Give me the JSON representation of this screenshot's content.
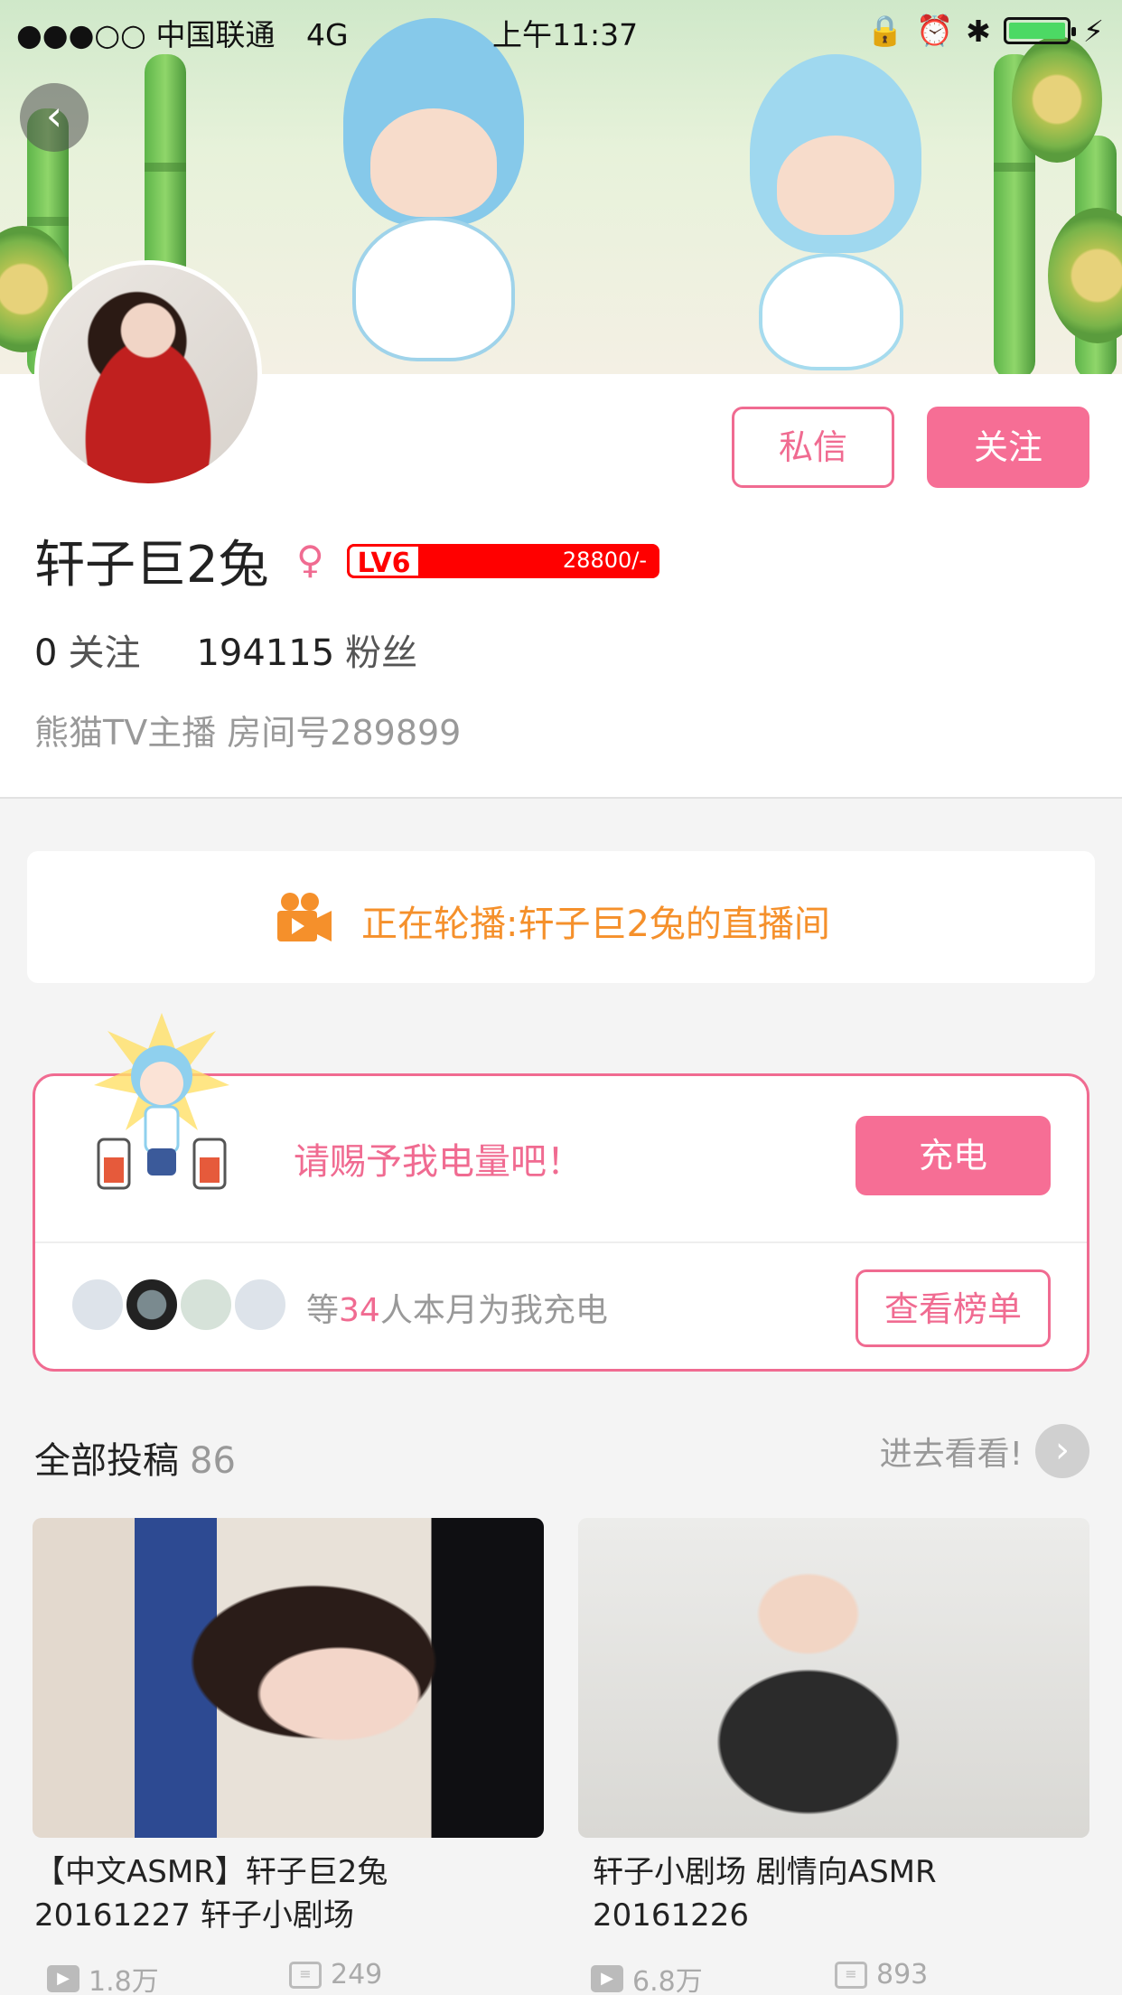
{
  "status_bar": {
    "carrier": "●●●○○ 中国联通",
    "network": "4G",
    "time": "上午11:37"
  },
  "profile": {
    "username": "轩子巨2兔",
    "level": "LV6",
    "exp": "28800/-",
    "following_count": "0",
    "following_label": "关注",
    "fans_count": "194115",
    "fans_label": "粉丝",
    "bio": "熊猫TV主播 房间号289899",
    "message_button": "私信",
    "follow_button": "关注"
  },
  "live": {
    "text": "正在轮播:轩子巨2兔的直播间"
  },
  "charge": {
    "prompt": "请赐予我电量吧！",
    "button": "充电",
    "supporters_prefix": "等",
    "supporters_count": "34",
    "supporters_suffix": "人本月为我充电",
    "rank_button": "查看榜单"
  },
  "posts": {
    "title": "全部投稿",
    "count": "86",
    "more_label": "进去看看!",
    "items": [
      {
        "title": "【中文ASMR】轩子巨2兔 20161227 轩子小剧场",
        "plays": "1.8万",
        "comments": "249"
      },
      {
        "title": "轩子小剧场 剧情向ASMR 20161226",
        "plays": "6.8万",
        "comments": "893"
      }
    ]
  },
  "colors": {
    "accent": "#f06b91",
    "live_orange": "#f5902b",
    "level_red": "#ff0000"
  }
}
